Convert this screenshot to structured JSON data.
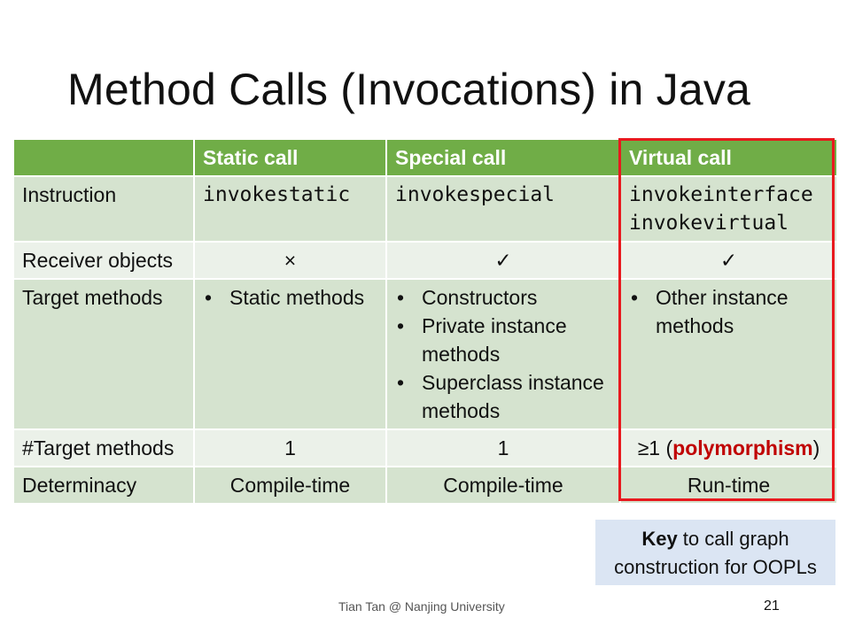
{
  "slide": {
    "title": "Method Calls (Invocations) in Java",
    "footer": "Tian Tan @ Nanjing University",
    "page_number": "21"
  },
  "table": {
    "headers": [
      "",
      "Static call",
      "Special call",
      "Virtual call"
    ],
    "instruction": {
      "label": "Instruction",
      "static": "invokestatic",
      "special": "invokespecial",
      "virtual_1": "invokeinterface",
      "virtual_2": "invokevirtual"
    },
    "receiver": {
      "label": "Receiver objects",
      "static": "×",
      "special": "✓",
      "virtual": "✓"
    },
    "targets": {
      "label": "Target methods",
      "static": [
        "Static methods"
      ],
      "special": [
        "Constructors",
        "Private instance methods",
        "Superclass instance methods"
      ],
      "virtual": [
        "Other instance methods"
      ]
    },
    "count": {
      "label": "#Target methods",
      "static": "1",
      "special": "1",
      "virtual_prefix": "≥1 (",
      "virtual_highlight": "polymorphism",
      "virtual_suffix": ")"
    },
    "determinacy": {
      "label": "Determinacy",
      "static": "Compile-time",
      "special": "Compile-time",
      "virtual": "Run-time"
    }
  },
  "key_box": {
    "bold": "Key",
    "line1_rest": " to call graph",
    "line2": "construction for OOPLs"
  },
  "colors": {
    "header_green": "#70ad47",
    "row_dark": "#d5e3cf",
    "row_light": "#ebf1e9",
    "highlight_border": "#e8191e",
    "highlight_text": "#c00000",
    "key_box_bg": "#dbe5f3"
  }
}
